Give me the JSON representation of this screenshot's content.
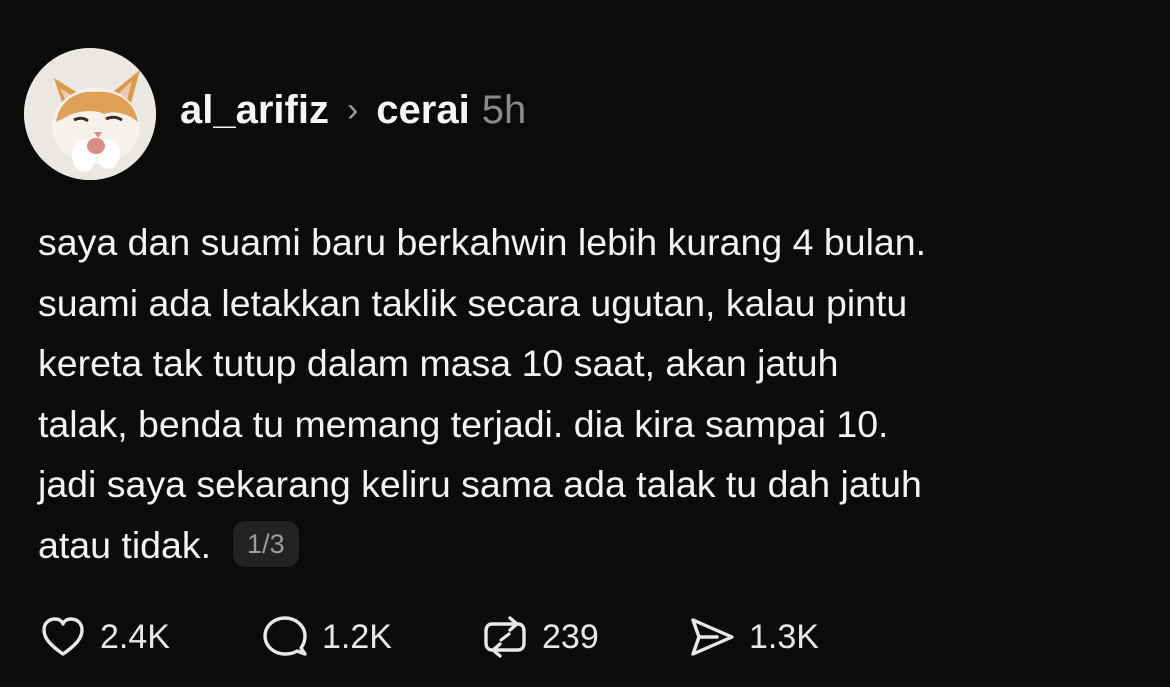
{
  "post": {
    "author": {
      "username": "al_arifiz",
      "avatar_icon": "cat-avatar-icon"
    },
    "separator_icon": "chevron-right-icon",
    "topic": "cerai",
    "time": "5h",
    "text_lines": [
      "saya dan suami baru berkahwin lebih kurang 4 bulan.",
      "suami ada letakkan taklik secara ugutan, kalau pintu",
      "kereta tak tutup dalam masa 10 saat, akan jatuh",
      "talak, benda tu memang terjadi. dia kira sampai 10.",
      "jadi saya sekarang keliru sama ada talak tu dah jatuh",
      "atau tidak."
    ],
    "page_indicator": "1/3",
    "actions": {
      "likes": {
        "icon": "heart-icon",
        "count": "2.4K"
      },
      "replies": {
        "icon": "comment-icon",
        "count": "1.2K"
      },
      "reposts": {
        "icon": "repost-icon",
        "count": "239"
      },
      "shares": {
        "icon": "share-icon",
        "count": "1.3K"
      }
    }
  },
  "colors": {
    "background": "#0b0b0b",
    "text": "#f3f3f3",
    "muted": "#8a8a8a",
    "badge_bg": "#232323"
  }
}
